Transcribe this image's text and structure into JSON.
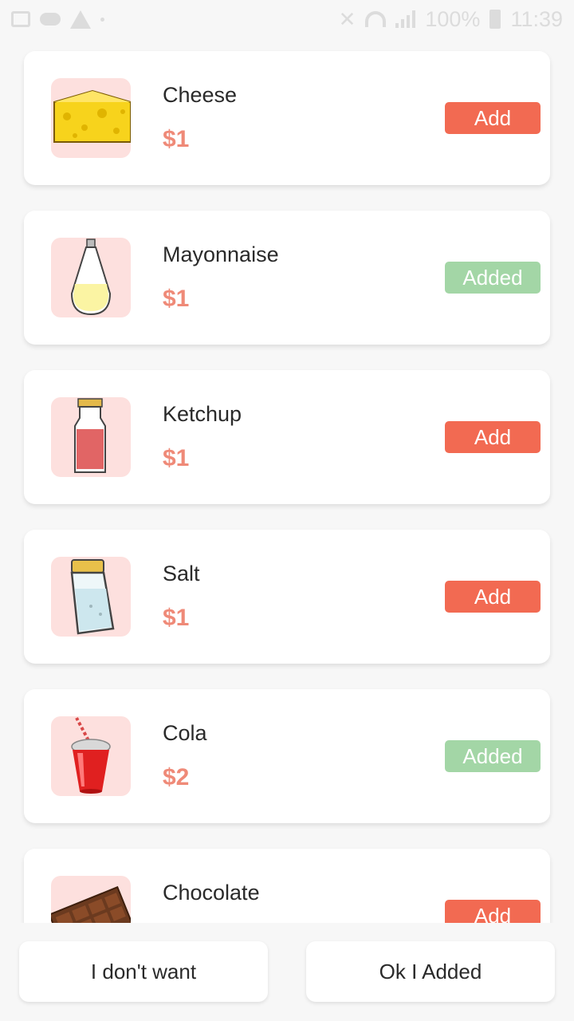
{
  "status_bar": {
    "battery": "100%",
    "time": "11:39",
    "icons": [
      "image-icon",
      "cloud-icon",
      "warning-icon",
      "mute-icon",
      "wifi-icon",
      "signal-icon",
      "battery-icon"
    ]
  },
  "items": [
    {
      "name": "Cheese",
      "price": "$1",
      "button": "Add",
      "state": "add",
      "icon": "cheese-icon"
    },
    {
      "name": "Mayonnaise",
      "price": "$1",
      "button": "Added",
      "state": "added",
      "icon": "mayonnaise-bottle-icon"
    },
    {
      "name": "Ketchup",
      "price": "$1",
      "button": "Add",
      "state": "add",
      "icon": "ketchup-bottle-icon"
    },
    {
      "name": "Salt",
      "price": "$1",
      "button": "Add",
      "state": "add",
      "icon": "salt-shaker-icon"
    },
    {
      "name": "Cola",
      "price": "$2",
      "button": "Added",
      "state": "added",
      "icon": "cola-cup-icon"
    },
    {
      "name": "Chocolate",
      "price": "",
      "button": "Add",
      "state": "add",
      "icon": "chocolate-bar-icon"
    }
  ],
  "actions": {
    "decline": "I don't want",
    "confirm": "Ok I Added"
  },
  "colors": {
    "add_button": "#f26a52",
    "added_button": "#a3d6a6",
    "price": "#ef8a78",
    "thumb_bg": "#fde0de"
  }
}
